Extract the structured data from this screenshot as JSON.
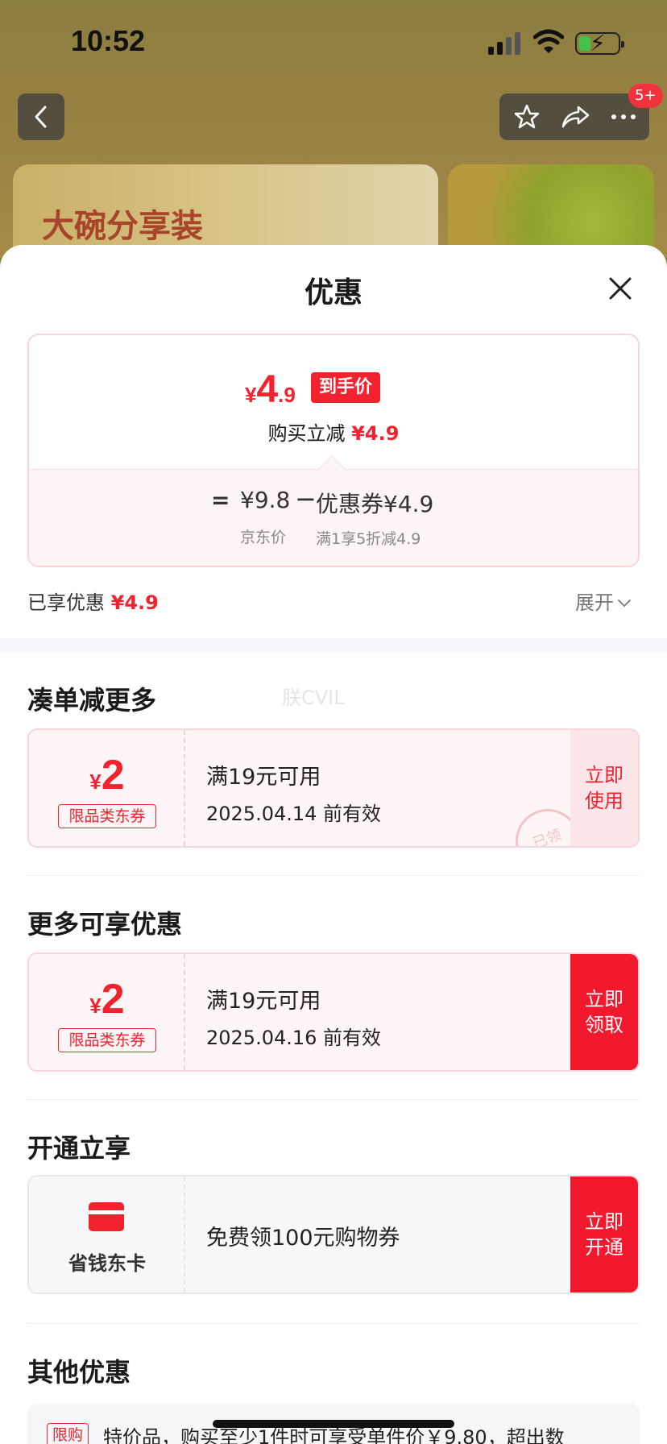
{
  "status_bar": {
    "time": "10:52"
  },
  "nav": {
    "badge": "5+"
  },
  "background": {
    "banner_text": "大碗分享装"
  },
  "sheet": {
    "title": "优惠",
    "price_card": {
      "currency": "¥",
      "price_int": "4",
      "price_dec": ".9",
      "price_tag": "到手价",
      "buy_reduce_label": "购买立减",
      "buy_reduce_value": "¥4.9",
      "equals": "=",
      "jd_price": "¥9.8",
      "minus": "−",
      "coupon_value": "优惠券¥4.9",
      "jd_price_label": "京东价",
      "coupon_label": "满1享5折减4.9"
    },
    "enjoyed_label": "已享优惠",
    "enjoyed_value": "¥4.9",
    "expand_label": "展开",
    "watermark": "朕CVIL",
    "sections": {
      "more_discount": {
        "title": "凑单减更多",
        "coupon": {
          "currency": "¥",
          "amount": "2",
          "category": "限品类东券",
          "condition": "满19元可用",
          "date": "2025.04.14 前有效",
          "button": "立即使用",
          "stamp": "已领"
        }
      },
      "more_offers": {
        "title": "更多可享优惠",
        "coupon": {
          "currency": "¥",
          "amount": "2",
          "category": "限品类东券",
          "condition": "满19元可用",
          "date": "2025.04.16 前有效",
          "button": "立即领取"
        }
      },
      "open_card": {
        "title": "开通立享",
        "card_name": "省钱东卡",
        "description": "免费领100元购物券",
        "button": "立即开通"
      },
      "other": {
        "title": "其他优惠",
        "tag": "限购",
        "text": "特价品，购买至少1件时可享受单件价￥9.80，超出数"
      }
    }
  },
  "colors": {
    "accent": "#f2232f",
    "brand_red": "#f2192f"
  }
}
